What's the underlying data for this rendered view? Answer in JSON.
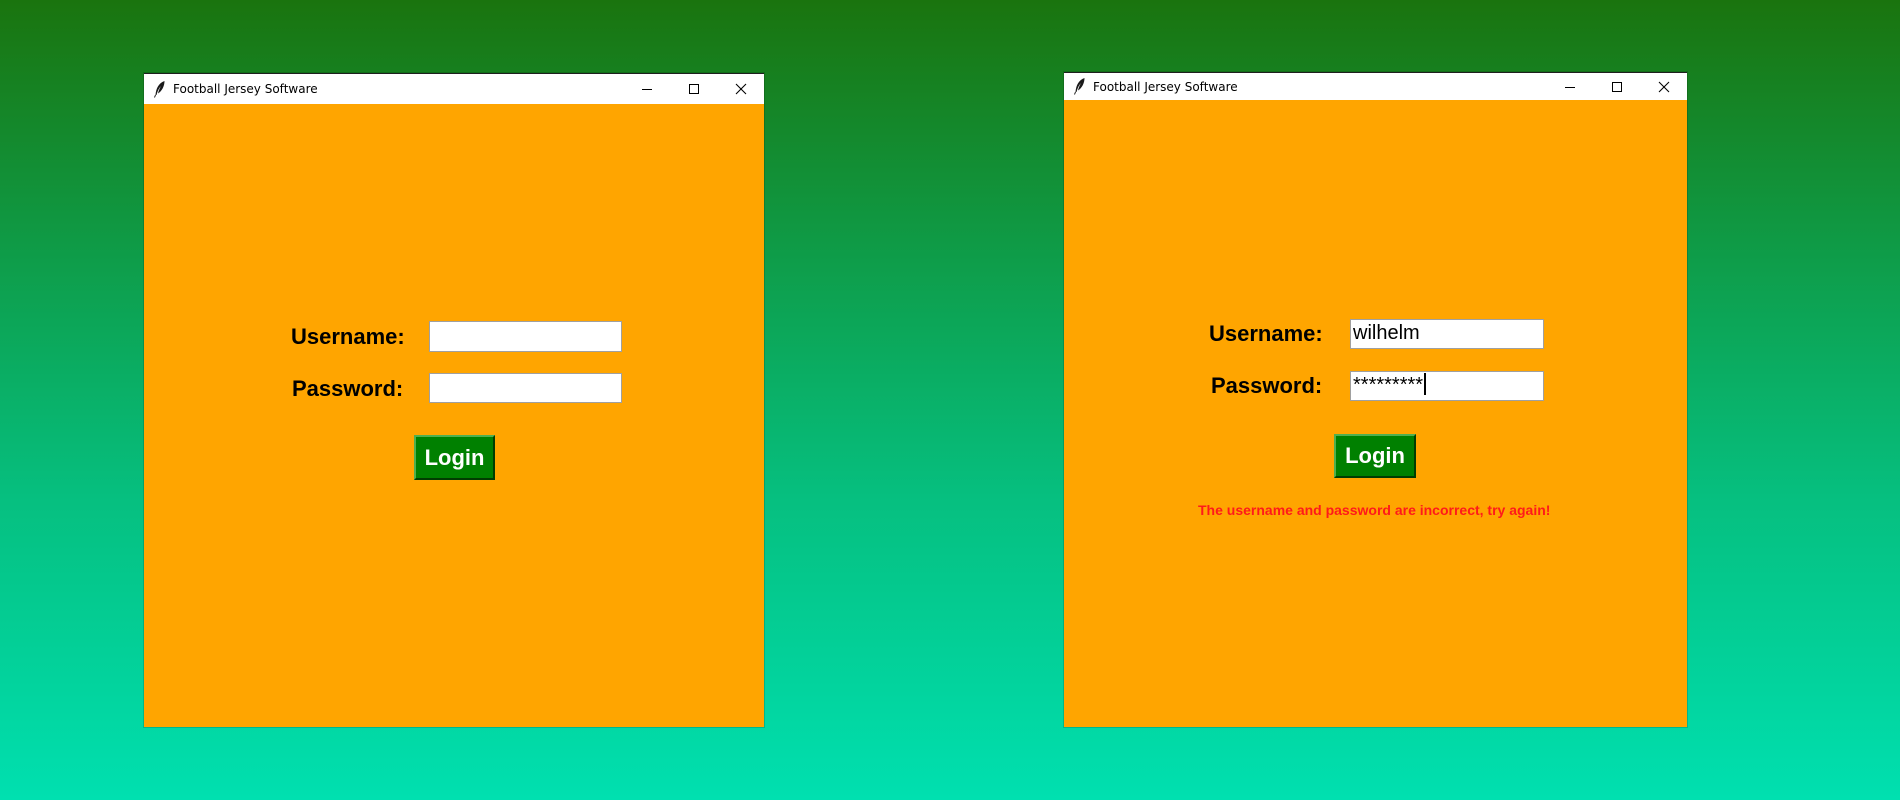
{
  "windows": [
    {
      "title": "Football Jersey Software",
      "icon": "feather-icon",
      "username_label": "Username:",
      "password_label": "Password:",
      "username_value": "",
      "password_value": "",
      "login_label": "Login",
      "error_message": ""
    },
    {
      "title": "Football Jersey Software",
      "icon": "feather-icon",
      "username_label": "Username:",
      "password_label": "Password:",
      "username_value": "wilhelm",
      "password_value": "*********",
      "login_label": "Login",
      "error_message": "The username and password are incorrect, try again!"
    }
  ],
  "colors": {
    "window_background": "#ffa500",
    "login_button": "#008000",
    "error_text": "#ff1a1a",
    "desktop_gradient_top": "#1a740e",
    "desktop_gradient_bottom": "#00e0b0"
  }
}
